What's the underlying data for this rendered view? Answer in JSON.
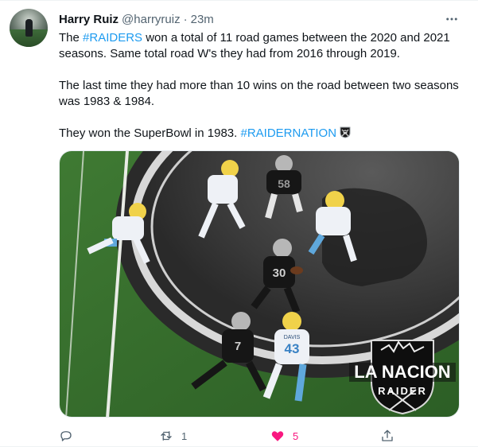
{
  "tweet": {
    "author": {
      "name": "Harry Ruiz",
      "handle": "@harryruiz",
      "separator": "·",
      "time": "23m"
    },
    "text": {
      "p1_pre": "The ",
      "p1_tag": "#RAIDERS",
      "p1_post": " won a total of 11 road games between the 2020 and 2021 seasons. Same total road W's they had from 2016 through 2019.",
      "p2": "The last time they had more than 10 wins on the road between two seasons was 1983 & 1984.",
      "p3_pre": "They won the SuperBowl in 1983. ",
      "p3_tag": "#RAIDERNATION"
    },
    "media": {
      "jersey_numbers": [
        "58",
        "30",
        "7",
        "43"
      ],
      "name_bar": "DAVIS",
      "watermark_line1": "LA NACION",
      "watermark_line2": "RAIDER"
    },
    "actions": {
      "reply_icon": "reply-icon",
      "retweet_icon": "retweet-icon",
      "retweet_count": "1",
      "like_icon": "heart-filled-icon",
      "like_count": "5",
      "share_icon": "share-icon",
      "more_icon": "more-horizontal-icon",
      "like_color": "#f91880",
      "link_color": "#1d9bf0"
    }
  }
}
